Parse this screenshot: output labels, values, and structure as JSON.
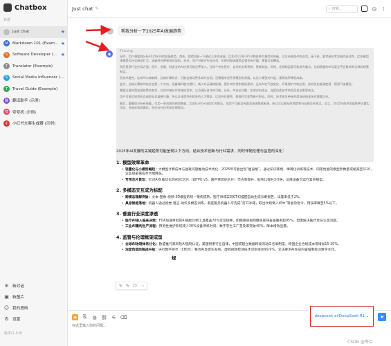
{
  "app": {
    "title": "Chatbox",
    "version": "版本(1.9.8)"
  },
  "sidebar": {
    "section_label": "对话",
    "items": [
      {
        "label": "Just chat",
        "avatar_color": "#bfbfbf",
        "avatar_text": "",
        "starred": true,
        "active": true
      },
      {
        "label": "Markdown 101 (Exam...",
        "avatar_color": "#3b6dd6",
        "avatar_text": "M",
        "starred": true,
        "active": false
      },
      {
        "label": "Software Developer (E...",
        "avatar_color": "#e0712c",
        "avatar_text": "S",
        "starred": true,
        "active": false
      },
      {
        "label": "Translator (Example)",
        "avatar_color": "#8b8b8b",
        "avatar_text": "T",
        "starred": false,
        "active": false
      },
      {
        "label": "Social Media Influencer (Ex...",
        "avatar_color": "#2fa3d8",
        "avatar_text": "S",
        "starred": false,
        "active": false
      },
      {
        "label": "Travel Guide (Example)",
        "avatar_color": "#33a853",
        "avatar_text": "T",
        "starred": false,
        "active": false
      },
      {
        "label": "翻译助手 (示例)",
        "avatar_color": "#6d4bd6",
        "avatar_text": "翻",
        "starred": false,
        "active": false
      },
      {
        "label": "夸夸机 (示例)",
        "avatar_color": "#e94560",
        "avatar_text": "夸",
        "starred": false,
        "active": false
      },
      {
        "label": "小红书文案生成器 (示例)",
        "avatar_color": "#d63031",
        "avatar_text": "小",
        "starred": false,
        "active": false
      }
    ],
    "bottom_items": [
      {
        "label": "新对话",
        "icon": "plus-icon"
      },
      {
        "label": "新图片",
        "icon": "image-icon"
      },
      {
        "label": "我的搭档",
        "icon": "people-icon"
      },
      {
        "label": "设置",
        "icon": "gear-icon"
      }
    ]
  },
  "header": {
    "chat_title": "Just chat",
    "search_placeholder": "搜索..."
  },
  "conversation": {
    "user_message": "帮我分析一下2025年AI发展趋势",
    "thinking_label": "Thinking",
    "thinking_paragraphs": [
      "好的，用户想要我分析2025年AI的发展趋势。首先，我得回顾一下最近几年的进展，比如2023年GPT-4和各种大模型的突破，以及多模态AI的应用。接下来，要考虑技术发展的延续性，比如模型规模是否还会继续扩大，或者转向更高效的架构。另外，用户可能对行业应用、伦理问题或政策监管也有兴趣，需要全面覆盖。",
      "然后是多行业应用方面，医疗、金融、制造业的AI应用可能会更深入。比如个性化医疗、自动化交易系统、智能制造。同时，伦理和监管可能成为重点，比如欧盟的AI法案会不会影响到全球的政策制定。",
      "而技术融合，比如AI与物联网、边缘计算结合，可能会推动更多实时应用。还需要考虑开源模型的发展，以及小模型的兴起，提高效率降低成本。",
      "此外，边缘计算和AI结合会是一个方向，设备端AI能力提升，减少对云端的依赖，提升实时性和隐私保护。还有AI在气候变化、环境保护中的应用，比如优化能源使用、预测气候模型。",
      "需要注意的是各国政策的差异，比如中美在AI领域的竞争，以及国际合作的可能。另外，AI安全问题，比如对抗攻击、深度伪造技术的防范也会更受关注。",
      "用户可能对投资机会或职业发展感兴趣，所以应该提到AI相关的人才需求，比如AI伦理师、数据科学家等新兴职业。同时，技术普及带来的就业结构变化也需要讨论。",
      "最后，要确保分析有依据，引用一些机构的预测数据，比如Gartner或IDC的报告，但用户可能没有要求具体数据来源，所以可以概括性地提到行业报告的观点。总之，2025年的AI发展将更注重实用化、合规化和普惠化，但仍存在技术和伦理挑战。"
    ],
    "answer_intro": "2025年AI发展的关键趋势可能呈现以下方向，结合技术创新与行业需求，同时伴随伦理与监管的深化：",
    "sections": [
      {
        "heading": "1. 模型效率革命",
        "items": [
          {
            "term": "轻量化与小模型崛起：",
            "text": "大模型计算成本与能耗问题推动技术优化，2025年可能出现“瘦身版”，通过知识蒸馏、稀疏化训练等技术，同等性能的模型参数量或缩减至1/10，企业级部署成本大幅降低。"
          },
          {
            "term": "专用芯片普及：",
            "text": "针对AI负载优化的ASIC芯片（如TPU v5、国产寒武纪芯片）市占率提升，能效比提升3-5倍，边缘设备可运行复杂模型。"
          }
        ]
      },
      {
        "heading": "2. 多模态交互成为标配",
        "items": [
          {
            "term": "跨模态理解突破：",
            "text": "文本-图像-视频-3D模型的统一架构成熟，医疗领域实现CT扫描图自动生成诊断报告，误差率低于2%。"
          },
          {
            "term": "具身智能落地：",
            "text": "机器人通过视觉-语言-动作多模态训练，家庭服务机器人可完成“打开冰箱，取出牛奶倒入杯中”等复杂指令，错误率降至5%以下。"
          }
        ]
      },
      {
        "heading": "3. 垂直行业深度渗透",
        "items": [
          {
            "term": "医疗AI进入临床决策：",
            "text": "FDA加速审批的AI辅助诊断工具覆盖70%常见病种，如糖尿病视网膜病变筛查准确率超95%，但需解决医疗责任认定问题。"
          },
          {
            "term": "工业AI重构生产流程：",
            "text": "预测性维护系统减少30%设备停机时间，数字孪生工厂普及率突破40%，降本增效显著。"
          }
        ]
      },
      {
        "heading": "4. 监管与伦理框架成型",
        "items": [
          {
            "term": "全球AI治理体系分化：",
            "text": "欧盟推行高风险AI强制认证，美国侧重行业自律，中国或建立数据跨境流动白名单制度，跨国企业合规成本或增加15-20%。"
          },
          {
            "term": "深度伪造防御战升级：",
            "text": "央行数字货币（CBDC）整合AI反欺诈系统，虚假视频检测技术识别率达99.9%，立法要求AI生成内容强制标注数字水印。"
          }
        ]
      }
    ],
    "partial_heading": "规"
  },
  "composer": {
    "placeholder": "在这里输入你的问题...",
    "model_label": "deepseek-ai/DeepSeek-R1 ⌄"
  },
  "watermark": "CSDN @冬兰"
}
